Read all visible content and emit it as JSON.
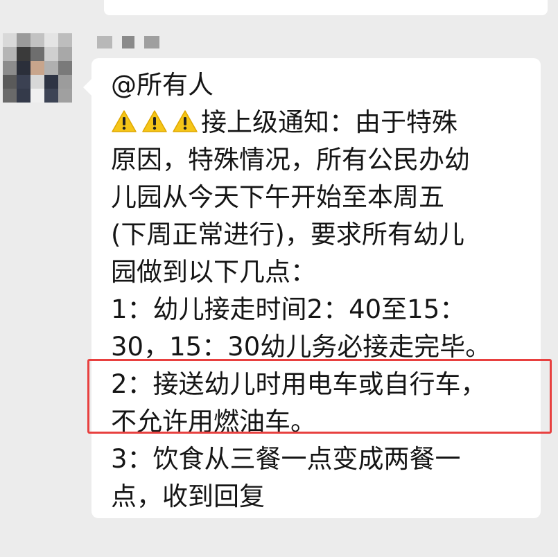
{
  "message": {
    "mention": "@所有人",
    "warning_icon_count": 3,
    "lines": [
      "接上级通知：由于特殊",
      "原因，特殊情况，所有公民办幼",
      "儿园从今天下午开始至本周五",
      "(下周正常进行)，要求所有幼儿",
      "园做到以下几点：",
      "1：幼儿接走时间2：40至15：",
      "30，15：30幼儿务必接走完毕。",
      "2：接送幼儿时用电车或自行车，",
      "不允许用燃油车。",
      "3：饮食从三餐一点变成两餐一",
      "点，收到回复"
    ]
  },
  "colors": {
    "background": "#ececec",
    "bubble": "#ffffff",
    "highlight_border": "#e8403f",
    "warning_fill": "#f5c518",
    "text": "#151515"
  },
  "icons": {
    "warning": "warning-triangle-icon",
    "avatar": "blurred-avatar"
  }
}
